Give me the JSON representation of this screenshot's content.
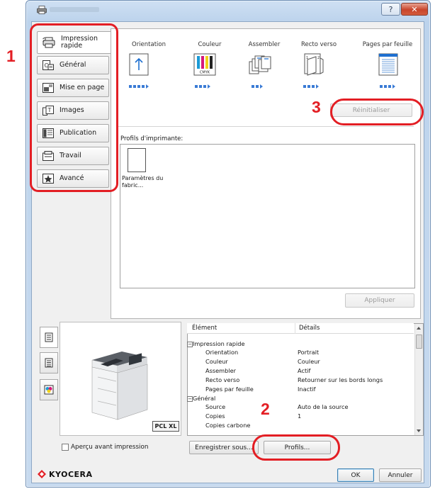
{
  "window": {
    "help_glyph": "?",
    "close_glyph": "✕"
  },
  "sidebar": {
    "tabs": [
      {
        "label": "Impression rapide",
        "icon": "quick-print-icon"
      },
      {
        "label": "Général",
        "icon": "general-icon"
      },
      {
        "label": "Mise en page",
        "icon": "layout-icon"
      },
      {
        "label": "Images",
        "icon": "image-icon"
      },
      {
        "label": "Publication",
        "icon": "publishing-icon"
      },
      {
        "label": "Travail",
        "icon": "job-icon"
      },
      {
        "label": "Avancé",
        "icon": "advanced-icon"
      }
    ]
  },
  "quick": {
    "columns": [
      "Orientation",
      "Couleur",
      "Assembler",
      "Recto verso",
      "Pages par feuille"
    ],
    "color_icon_text": "CMYK",
    "reset_label": "Réinitialiser",
    "profiles_label": "Profils d'imprimante:",
    "profile_name": "Paramètres du fabric...",
    "apply_label": "Appliquer"
  },
  "preview": {
    "pdl_badge": "PCL XL",
    "checkbox_label": "Aperçu avant impression"
  },
  "details": {
    "col_item": "Élément",
    "col_details": "Détails",
    "rows": [
      {
        "k": "Impression rapide",
        "v": "",
        "group": true
      },
      {
        "k": "Orientation",
        "v": "Portrait"
      },
      {
        "k": "Couleur",
        "v": "Couleur"
      },
      {
        "k": "Assembler",
        "v": "Actif"
      },
      {
        "k": "Recto verso",
        "v": "Retourner sur les bords longs"
      },
      {
        "k": "Pages par feuille",
        "v": "Inactif"
      },
      {
        "k": "Général",
        "v": "",
        "group": true
      },
      {
        "k": "Source",
        "v": "Auto de la source"
      },
      {
        "k": "Copies",
        "v": "1"
      },
      {
        "k": "Copies carbone",
        "v": ""
      }
    ]
  },
  "actions": {
    "save_as": "Enregistrer sous...",
    "profiles": "Profils...",
    "ok": "OK",
    "cancel": "Annuler"
  },
  "brand": {
    "logo_text": "KYOCERA",
    "logo_color": "#e31e24"
  },
  "annotations": {
    "n1": "1",
    "n2": "2",
    "n3": "3",
    "color": "#e31e24"
  }
}
